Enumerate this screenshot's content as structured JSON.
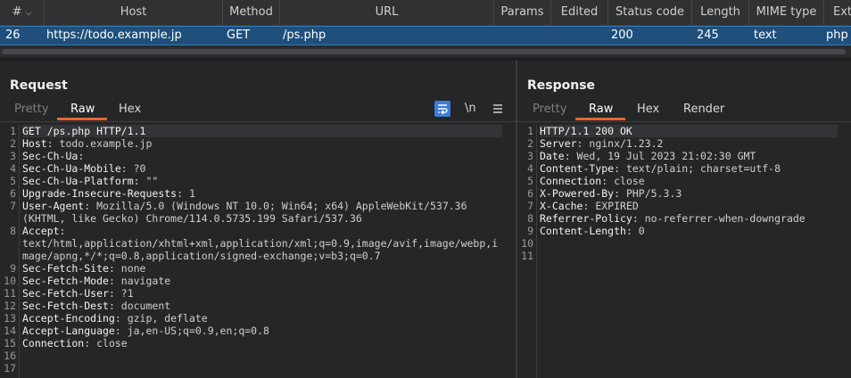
{
  "table": {
    "headers": [
      "#",
      "Host",
      "Method",
      "URL",
      "Params",
      "Edited",
      "Status code",
      "Length",
      "MIME type",
      "Exte"
    ],
    "row": {
      "num": "26",
      "host": "https://todo.example.jp",
      "method": "GET",
      "url": "/ps.php",
      "status": "200",
      "length": "245",
      "mime": "text",
      "ext": "php"
    }
  },
  "request": {
    "title": "Request",
    "tabs": [
      "Pretty",
      "Raw",
      "Hex"
    ],
    "active_tab": "Raw",
    "wrap_label": "\\n",
    "line_numbers": [
      "1",
      "2",
      "3",
      "4",
      "5",
      "6",
      "7",
      "",
      "8",
      "",
      "",
      "9",
      "10",
      "11",
      "12",
      "13",
      "14",
      "15",
      "16",
      "17"
    ],
    "lines": [
      {
        "k": "GET /ps.php HTTP/1.1",
        "v": ""
      },
      {
        "k": "Host",
        "v": ": todo.example.jp"
      },
      {
        "k": "Sec-Ch-Ua",
        "v": ":"
      },
      {
        "k": "Sec-Ch-Ua-Mobile",
        "v": ": ?0"
      },
      {
        "k": "Sec-Ch-Ua-Platform",
        "v": ": \"\""
      },
      {
        "k": "Upgrade-Insecure-Requests",
        "v": ": 1"
      },
      {
        "k": "User-Agent",
        "v": ": Mozilla/5.0 (Windows NT 10.0; Win64; x64) AppleWebKit/537.36"
      },
      {
        "k": "",
        "v": "(KHTML, like Gecko) Chrome/114.0.5735.199 Safari/537.36"
      },
      {
        "k": "Accept",
        "v": ":"
      },
      {
        "k": "",
        "v": "text/html,application/xhtml+xml,application/xml;q=0.9,image/avif,image/webp,i"
      },
      {
        "k": "",
        "v": "mage/apng,*/*;q=0.8,application/signed-exchange;v=b3;q=0.7"
      },
      {
        "k": "Sec-Fetch-Site",
        "v": ": none"
      },
      {
        "k": "Sec-Fetch-Mode",
        "v": ": navigate"
      },
      {
        "k": "Sec-Fetch-User",
        "v": ": ?1"
      },
      {
        "k": "Sec-Fetch-Dest",
        "v": ": document"
      },
      {
        "k": "Accept-Encoding",
        "v": ": gzip, deflate"
      },
      {
        "k": "Accept-Language",
        "v": ": ja,en-US;q=0.9,en;q=0.8"
      },
      {
        "k": "Connection",
        "v": ": close"
      },
      {
        "k": "",
        "v": ""
      },
      {
        "k": "",
        "v": ""
      }
    ]
  },
  "response": {
    "title": "Response",
    "tabs": [
      "Pretty",
      "Raw",
      "Hex",
      "Render"
    ],
    "active_tab": "Raw",
    "line_numbers": [
      "1",
      "2",
      "3",
      "4",
      "5",
      "6",
      "7",
      "8",
      "9",
      "10",
      "11"
    ],
    "lines": [
      {
        "k": "HTTP/1.1 200 OK",
        "v": ""
      },
      {
        "k": "Server",
        "v": ": nginx/1.23.2"
      },
      {
        "k": "Date",
        "v": ": Wed, 19 Jul 2023 21:02:30 GMT"
      },
      {
        "k": "Content-Type",
        "v": ": text/plain; charset=utf-8"
      },
      {
        "k": "Connection",
        "v": ": close"
      },
      {
        "k": "X-Powered-By",
        "v": ": PHP/5.3.3"
      },
      {
        "k": "X-Cache",
        "v": ": EXPIRED"
      },
      {
        "k": "Referrer-Policy",
        "v": ": no-referrer-when-downgrade"
      },
      {
        "k": "Content-Length",
        "v": ": 0"
      },
      {
        "k": "",
        "v": ""
      },
      {
        "k": "",
        "v": ""
      }
    ]
  },
  "colors": {
    "accent": "#e06a35",
    "selection": "#1f4f7a",
    "wrap_button": "#3b7dd8"
  }
}
